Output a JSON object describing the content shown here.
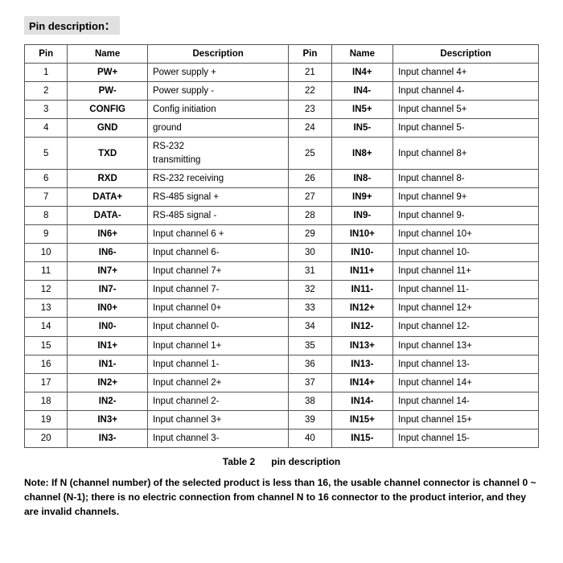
{
  "header": {
    "title": "Pin description："
  },
  "table": {
    "columns_left": [
      "Pin",
      "Name",
      "Description"
    ],
    "columns_right": [
      "Pin",
      "Name",
      "Description"
    ],
    "rows": [
      {
        "pin_l": "1",
        "name_l": "PW+",
        "desc_l": "Power supply +",
        "pin_r": "21",
        "name_r": "IN4+",
        "desc_r": "Input channel 4+"
      },
      {
        "pin_l": "2",
        "name_l": "PW-",
        "desc_l": "Power supply -",
        "pin_r": "22",
        "name_r": "IN4-",
        "desc_r": "Input channel 4-"
      },
      {
        "pin_l": "3",
        "name_l": "CONFIG",
        "desc_l": "Config initiation",
        "pin_r": "23",
        "name_r": "IN5+",
        "desc_r": "Input channel 5+"
      },
      {
        "pin_l": "4",
        "name_l": "GND",
        "desc_l": "ground",
        "pin_r": "24",
        "name_r": "IN5-",
        "desc_r": "Input channel 5-"
      },
      {
        "pin_l": "5",
        "name_l": "TXD",
        "desc_l": "RS-232\ntransmitting",
        "pin_r": "25",
        "name_r": "IN8+",
        "desc_r": "Input channel 8+"
      },
      {
        "pin_l": "6",
        "name_l": "RXD",
        "desc_l": "RS-232 receiving",
        "pin_r": "26",
        "name_r": "IN8-",
        "desc_r": "Input channel 8-"
      },
      {
        "pin_l": "7",
        "name_l": "DATA+",
        "desc_l": "RS-485 signal +",
        "pin_r": "27",
        "name_r": "IN9+",
        "desc_r": "Input channel 9+"
      },
      {
        "pin_l": "8",
        "name_l": "DATA-",
        "desc_l": "RS-485 signal -",
        "pin_r": "28",
        "name_r": "IN9-",
        "desc_r": "Input channel 9-"
      },
      {
        "pin_l": "9",
        "name_l": "IN6+",
        "desc_l": "Input channel 6 +",
        "pin_r": "29",
        "name_r": "IN10+",
        "desc_r": "Input channel 10+"
      },
      {
        "pin_l": "10",
        "name_l": "IN6-",
        "desc_l": "Input channel 6-",
        "pin_r": "30",
        "name_r": "IN10-",
        "desc_r": "Input channel 10-"
      },
      {
        "pin_l": "11",
        "name_l": "IN7+",
        "desc_l": "Input channel 7+",
        "pin_r": "31",
        "name_r": "IN11+",
        "desc_r": "Input channel 11+"
      },
      {
        "pin_l": "12",
        "name_l": "IN7-",
        "desc_l": "Input channel 7-",
        "pin_r": "32",
        "name_r": "IN11-",
        "desc_r": "Input channel 11-"
      },
      {
        "pin_l": "13",
        "name_l": "IN0+",
        "desc_l": "Input channel 0+",
        "pin_r": "33",
        "name_r": "IN12+",
        "desc_r": "Input channel 12+"
      },
      {
        "pin_l": "14",
        "name_l": "IN0-",
        "desc_l": "Input channel 0-",
        "pin_r": "34",
        "name_r": "IN12-",
        "desc_r": "Input channel 12-"
      },
      {
        "pin_l": "15",
        "name_l": "IN1+",
        "desc_l": "Input channel 1+",
        "pin_r": "35",
        "name_r": "IN13+",
        "desc_r": "Input channel 13+"
      },
      {
        "pin_l": "16",
        "name_l": "IN1-",
        "desc_l": "Input channel 1-",
        "pin_r": "36",
        "name_r": "IN13-",
        "desc_r": "Input channel 13-"
      },
      {
        "pin_l": "17",
        "name_l": "IN2+",
        "desc_l": "Input channel 2+",
        "pin_r": "37",
        "name_r": "IN14+",
        "desc_r": "Input channel 14+"
      },
      {
        "pin_l": "18",
        "name_l": "IN2-",
        "desc_l": "Input channel 2-",
        "pin_r": "38",
        "name_r": "IN14-",
        "desc_r": "Input channel 14-"
      },
      {
        "pin_l": "19",
        "name_l": "IN3+",
        "desc_l": "Input channel 3+",
        "pin_r": "39",
        "name_r": "IN15+",
        "desc_r": "Input channel 15+"
      },
      {
        "pin_l": "20",
        "name_l": "IN3-",
        "desc_l": "Input channel 3-",
        "pin_r": "40",
        "name_r": "IN15-",
        "desc_r": "Input channel 15-"
      }
    ]
  },
  "caption": {
    "table_label": "Table 2",
    "description": "pin description"
  },
  "note": {
    "text": "Note: If N (channel number) of the selected product is less than 16, the usable channel connector is channel 0 ~ channel (N-1); there is no electric connection from channel N to 16 connector to the product interior, and they are invalid channels."
  }
}
